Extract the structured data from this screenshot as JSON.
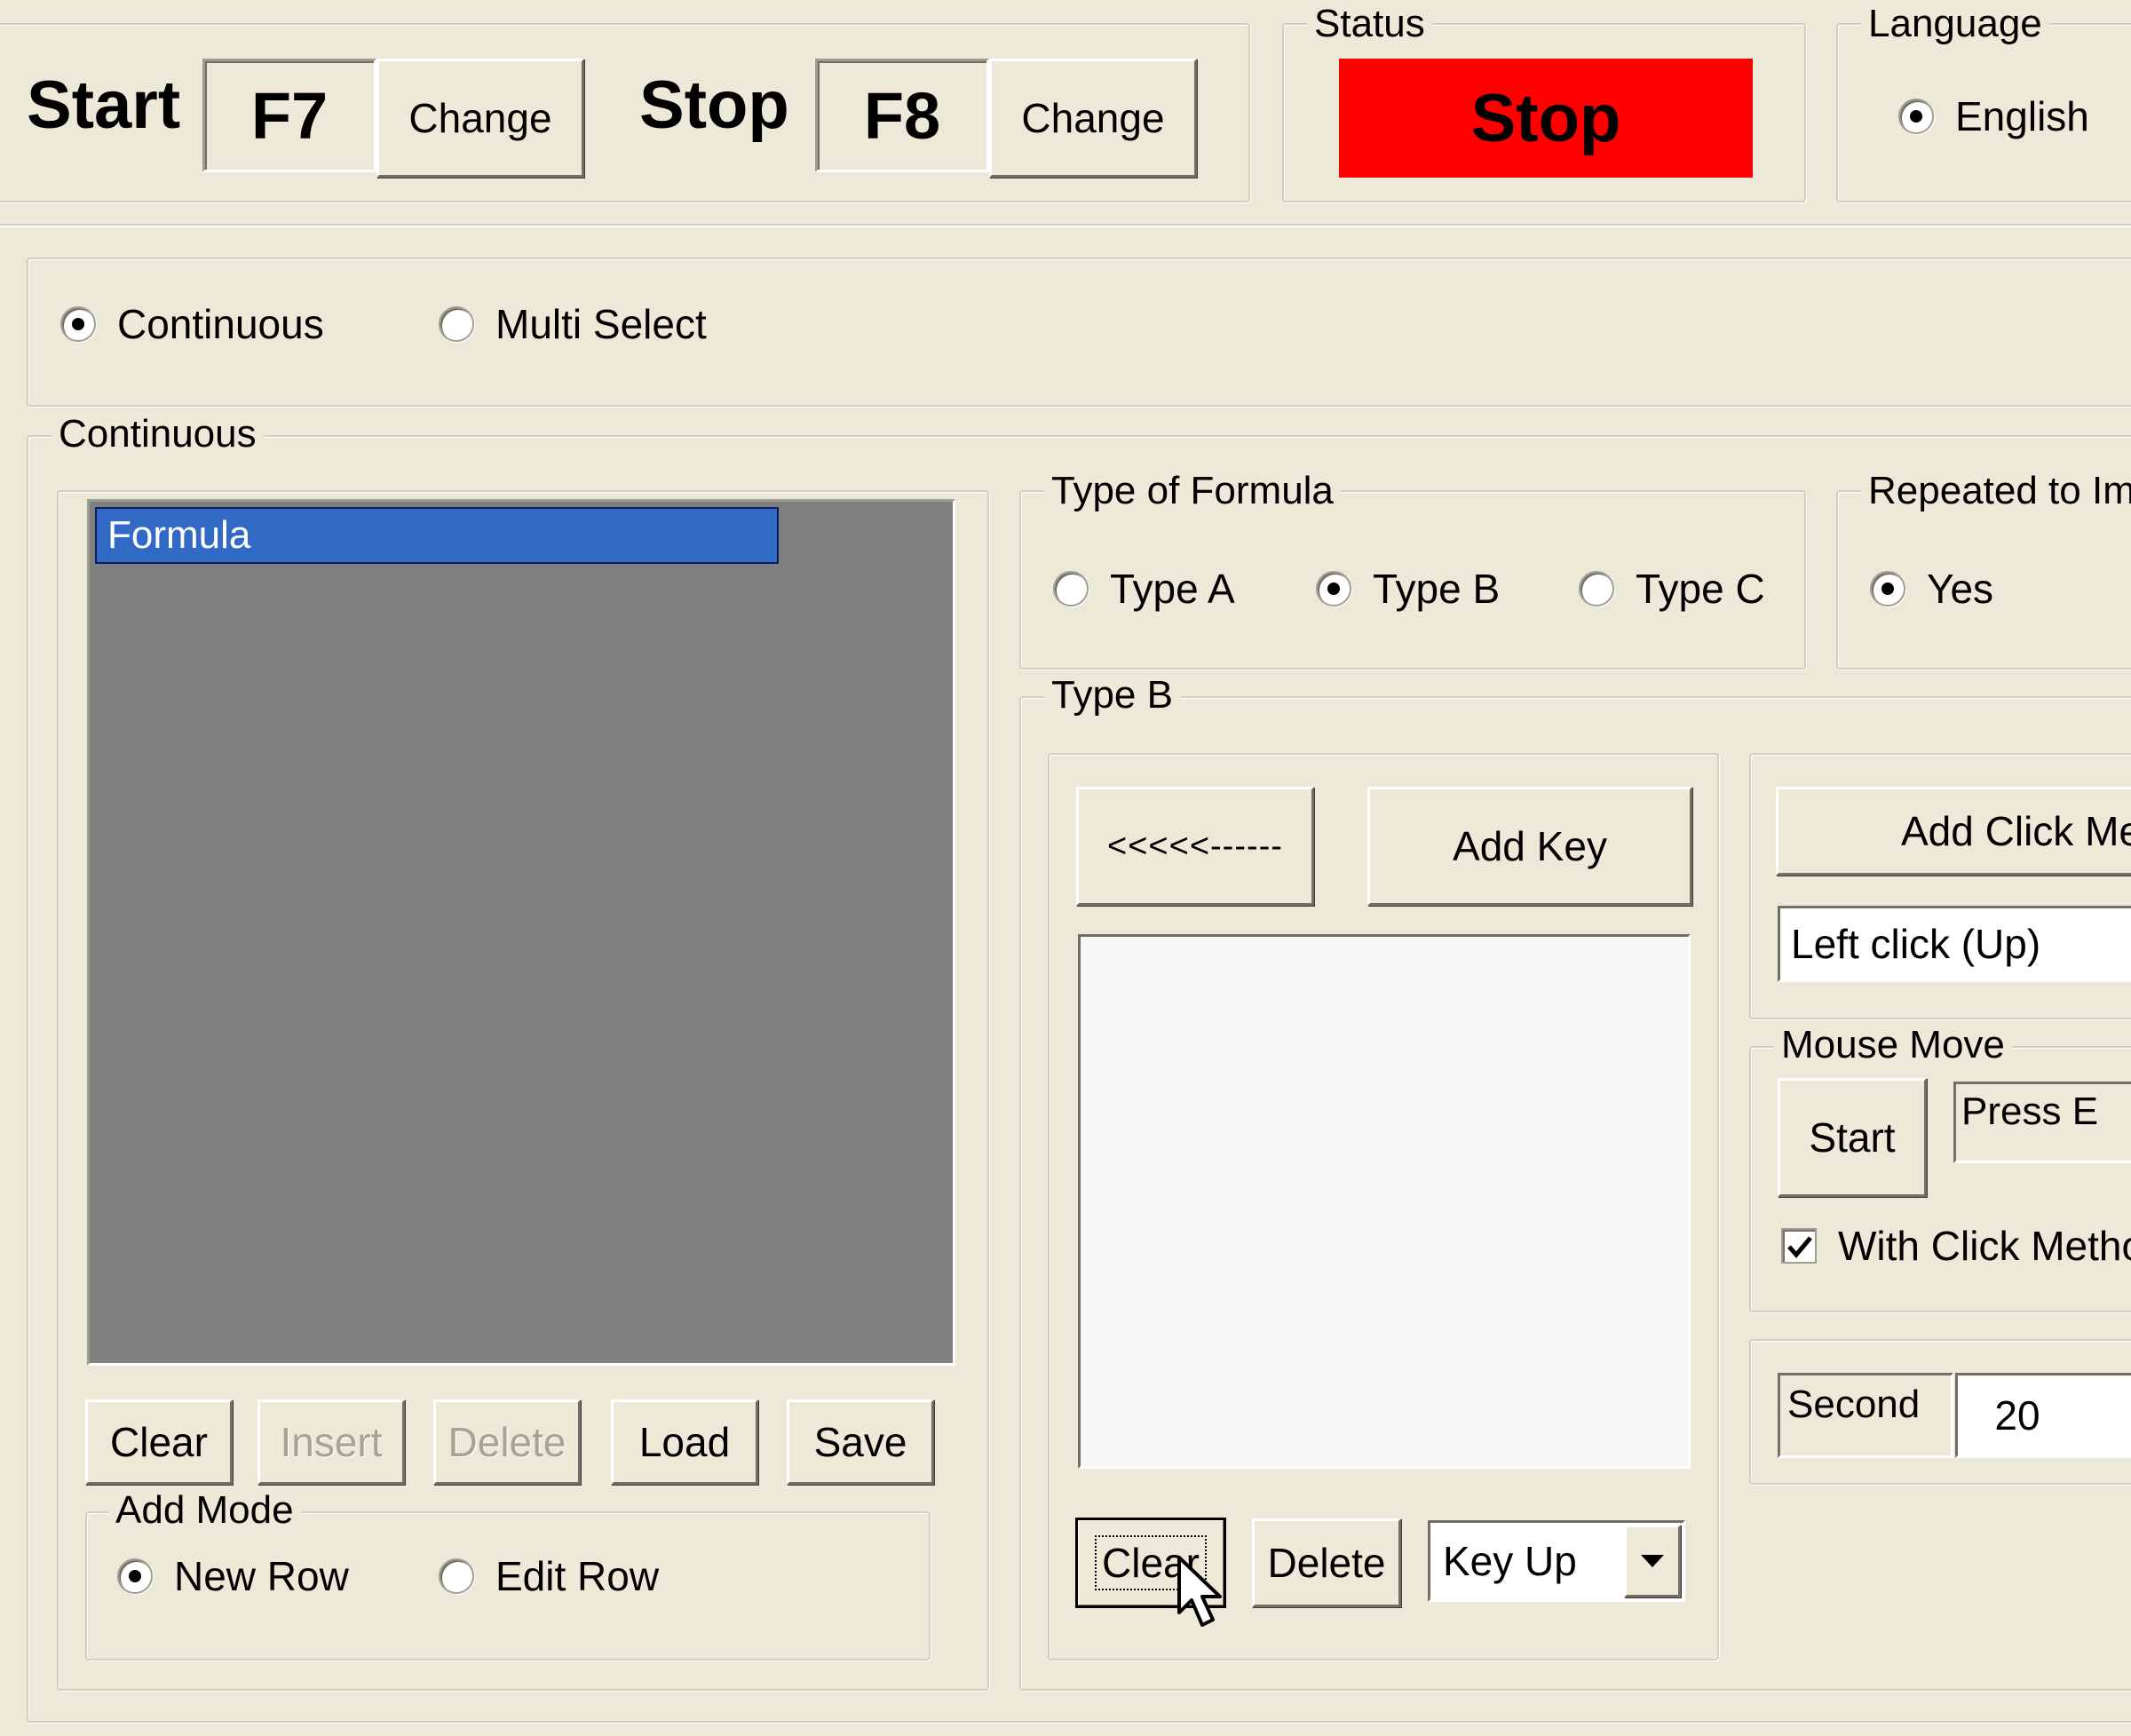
{
  "hotkeys": {
    "start_label": "Start",
    "start_key": "F7",
    "stop_label": "Stop",
    "stop_key": "F8",
    "change_label": "Change"
  },
  "status": {
    "legend": "Status",
    "value": "Stop",
    "color": "#ff0000"
  },
  "language": {
    "legend": "Language",
    "option": "English"
  },
  "mode": {
    "continuous": "Continuous",
    "multi_select": "Multi Select",
    "selected": "continuous"
  },
  "continuous_panel": {
    "legend": "Continuous",
    "list": {
      "items": [
        "Formula"
      ],
      "selected_color": "#316ac5",
      "background": "#808080"
    },
    "buttons": {
      "clear": "Clear",
      "insert": "Insert",
      "delete": "Delete",
      "load": "Load",
      "save": "Save"
    },
    "add_mode": {
      "legend": "Add Mode",
      "new_row": "New Row",
      "edit_row": "Edit Row"
    }
  },
  "formula_type": {
    "legend": "Type of Formula",
    "type_a": "Type A",
    "type_b": "Type B",
    "type_c": "Type C"
  },
  "repeated": {
    "legend": "Repeated to Im",
    "yes": "Yes"
  },
  "type_b": {
    "legend": "Type B",
    "arrow_button": "<<<<<------",
    "add_key": "Add Key",
    "clear": "Clear",
    "delete": "Delete",
    "key_select": "Key Up"
  },
  "click_method": {
    "add_click": "Add Click Me",
    "click_select": "Left click (Up)"
  },
  "mouse_move": {
    "legend": "Mouse Move",
    "start": "Start",
    "press_hint": "Press E",
    "with_click": "With Click Metho"
  },
  "timing": {
    "second_label": "Second",
    "second_value": "20"
  }
}
